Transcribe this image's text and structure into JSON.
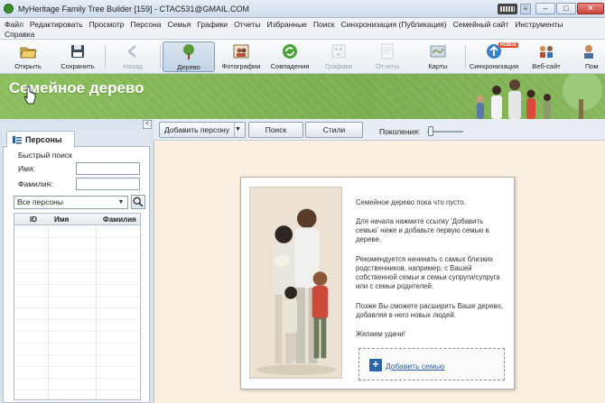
{
  "window": {
    "title": "MyHeritage Family Tree Builder [159] - CTAC531@GMAIL.COM",
    "lang_label": "≡",
    "minimize": "–",
    "maximize": "□",
    "close": "✕"
  },
  "menu": {
    "row1": [
      "Файл",
      "Редактировать",
      "Просмотр",
      "Персона",
      "Семья",
      "Графики",
      "Отчеты",
      "Избранные",
      "Поиск",
      "Синхронизация (Публикация)",
      "Семейный сайт",
      "Инструменты"
    ],
    "row2": [
      "Справка"
    ]
  },
  "toolbar": {
    "open": "Открыть",
    "save": "Сохранить",
    "back": "Назад",
    "tree": "Дерево",
    "photos": "Фотографии",
    "matches": "Совпадения",
    "charts": "Графики",
    "reports": "Отчеты",
    "maps": "Карты",
    "sync": "Синхронизация",
    "site": "Веб-сайт",
    "help": "Пом",
    "new_badge": "НОВОЕ"
  },
  "header": {
    "title": "Семейное дерево"
  },
  "left_panel": {
    "collapse": "<",
    "tab_label": "Персоны",
    "quick_search": "Быстрый поиск",
    "first_name_label": "Имя:",
    "last_name_label": "Фамилия:",
    "first_name_value": "",
    "last_name_value": "",
    "filter_selected": "Все персоны",
    "columns": [
      "ID",
      "Имя",
      "Фамилия"
    ]
  },
  "main": {
    "add_person": "Добавить персону",
    "search": "Поиск",
    "styles": "Стили",
    "generations_label": "Поколения:",
    "generations_level": 0.05,
    "message": [
      "Семейное дерево пока что пусто.",
      "Для начала нажмите ссылку 'Добавить семью' ниже и добавьте первую семью в дереве.",
      "Рекомендуется начинать с самых близких родственников, например, с Вашей собственной семьи и семьи супруги/супруга или с семьи родителей.",
      "Позже Вы сможете расширить Ваше дерево, добавляя в него новых людей.",
      "Желаем удачи!"
    ],
    "add_family": "Добавить семью"
  },
  "colors": {
    "header_green": "#7fb251",
    "canvas_bg": "#fbefe0",
    "link_blue": "#2a5d9a"
  }
}
